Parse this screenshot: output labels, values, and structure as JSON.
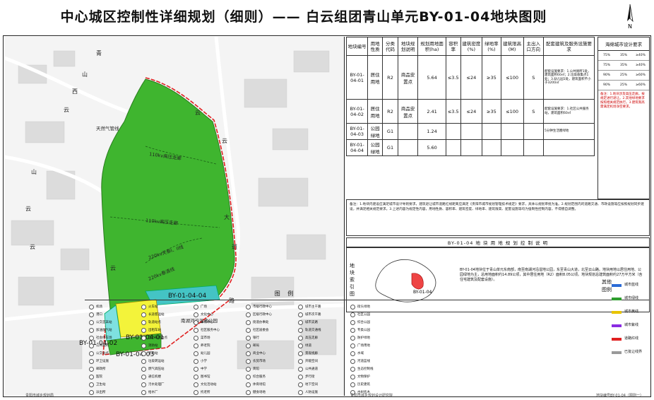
{
  "title": "中心城区控制性详细规划（细则）——  白云组团青山单元BY-01-04地块图则",
  "north": {
    "label": "N"
  },
  "map": {
    "labels": {
      "gas_station": "天然气管线",
      "line_a": "110kv高压走廊",
      "line_b": "110kv高压走廊",
      "line_c": "220kv天泰I、II线",
      "line_d": "220kv泰清线",
      "zhuhu": "主湖",
      "park": "南湖河沿湿地公园",
      "rd_qing": "青",
      "rd_shan": "山",
      "rd_xi": "西",
      "rd_yun1": "云",
      "rd_yun2": "云",
      "rd_yun3": "云",
      "rd_da": "大",
      "rd_dao": "道",
      "rd_shan2": "山",
      "rd_yun4": "云",
      "rd_tu": "图",
      "rd_lu": "路",
      "rd_yun5": "云",
      "rd_yun6": "云"
    },
    "parcels": {
      "p04": "BY-01-04-04",
      "p01": "BY-01-04-01",
      "p02": "BY-01-04-02",
      "p03": "BY-01-04-03"
    }
  },
  "control_table": {
    "headers": [
      "地块编号",
      "用地性质",
      "分类代码",
      "地块规划说明",
      "规划用地面积(ha)",
      "容积率",
      "建筑密度(%)",
      "绿地率(%)",
      "建筑限高(M)",
      "主出入口方向",
      "配套建筑及服务设施要求"
    ],
    "rows": [
      [
        "BY-01-04-01",
        "居住用地",
        "R2",
        "商品安置点",
        "5.64",
        "≤3.5",
        "≤24",
        "≥35",
        "≤100",
        "S",
        "配套设施要求：1.公共厕所1处，建筑面积60㎡；2.垃圾收集点1处；3.幼儿园1处，建筑面积不小于3200㎡"
      ],
      [
        "BY-01-04-02",
        "居住用地",
        "R2",
        "商品安置点",
        "2.41",
        "≤3.5",
        "≤24",
        "≥35",
        "≤100",
        "S",
        "配套设施要求：1.社区公共服务站，建筑面积60㎡"
      ],
      [
        "BY-01-04-03",
        "公园绿地",
        "G1",
        "",
        "1.24",
        "",
        "",
        "",
        "",
        "",
        "5分钟生活圈绿地"
      ],
      [
        "BY-01-04-04",
        "公园绿地",
        "G1",
        "",
        "5.60",
        "",
        "",
        "",
        "",
        "",
        ""
      ]
    ]
  },
  "urban_design": {
    "title": "海绵城市设计要求",
    "rows": [
      [
        "75%",
        "35%",
        "≥40%"
      ],
      [
        "75%",
        "35%",
        "≥40%"
      ],
      [
        "90%",
        "25%",
        "≥60%"
      ],
      [
        "90%",
        "25%",
        "≥60%"
      ]
    ],
    "note": "备注：1.地块涉及高压走廊，按规定进行退让。2.其他绿地要求按照相关规范执行。3.建筑限高需满足机场净空要求。"
  },
  "notes": "备注：1.地块内建设应满足城市设计导则要求，建筑退让城市道路红线距离应满足《贵阳市城市规划管理技术规定》要求，具体以规划审批为准。2.规划范围内的道路交通、市政设施等应按照规划同步建设，并满足相关规范要求。3.上述内容为规定性内容，用地性质、容积率、建筑密度、绿地率、建筑限高、配套设施等均为强制性控制内容，不得擅自调整。",
  "plan_title": "BY-01-04  地 块 用 地 规 划 控 制 说 明",
  "index": {
    "label": "地块索引图",
    "parcel_tag": "BY-01-04",
    "desc": "BY-01-04地块位于青山单元东南部，南至南湖河沿湿地公园，东至青山大道，北至云山路。地块用地以居住用地、公园绿地为主，总用地面积约14.89公顷，其中居住用地（R2）面积8.05公顷。地块规划总建筑面积约27万平方米（含住宅建筑及配套设施）。"
  },
  "legend": {
    "title": "图    例",
    "col1": [
      "机场",
      "港口",
      "公交首末站",
      "加油加气站",
      "社会停车场",
      "公共厕所",
      "公交站点",
      "环卫设施",
      "邮政所",
      "医院",
      "卫生站",
      "派出所"
    ],
    "col2": [
      "火车站",
      "长途客运站",
      "轨道站点",
      "出租车站",
      "自行车停放点",
      "消防站",
      "变电站",
      "垃圾转运站",
      "燃气调压站",
      "通信机楼",
      "污水处理厂",
      "给水厂"
    ],
    "col3": [
      "广场",
      "文化中心",
      "体育中心",
      "社区服务中心",
      "菜市场",
      "养老院",
      "幼儿园",
      "小学",
      "中学",
      "图书馆",
      "文化活动站",
      "托老所"
    ],
    "col4": [
      "市级行政中心",
      "区级行政中心",
      "街道办事处",
      "社区居委会",
      "银行",
      "邮局",
      "商业中心",
      "农贸市场",
      "宾馆",
      "综合服务",
      "体育场馆",
      "健身场地"
    ],
    "col5": [
      "城市主干路",
      "城市次干路",
      "城市支路",
      "轨道交通线",
      "高压走廊",
      "绿道",
      "景观视廊",
      "开敞空间",
      "公共通道",
      "步行街",
      "地下空间",
      "人防设施"
    ],
    "col6": [
      "街头绿地",
      "社区公园",
      "综合公园",
      "专类公园",
      "防护绿地",
      "广场用地",
      "水域",
      "河道蓝线",
      "生态控制线",
      "文物保护",
      "历史建筑",
      "古树名木"
    ],
    "other_title": "其他图例",
    "lines": [
      {
        "name": "城市蓝线",
        "color": "#2b6bd6"
      },
      {
        "name": "城市绿线",
        "color": "#2e9e2e"
      },
      {
        "name": "城市黄线",
        "color": "#e8c400"
      },
      {
        "name": "城市紫线",
        "color": "#8a2be2"
      },
      {
        "name": "道路红线",
        "color": "#e02020"
      },
      {
        "name": "已批让线界",
        "color": "#999999"
      }
    ]
  },
  "footer": {
    "left": "贵阳市城乡规划局",
    "center": "贵阳市城乡规划设计研究院",
    "right": "地块编号BY-01-04（图则一）"
  }
}
